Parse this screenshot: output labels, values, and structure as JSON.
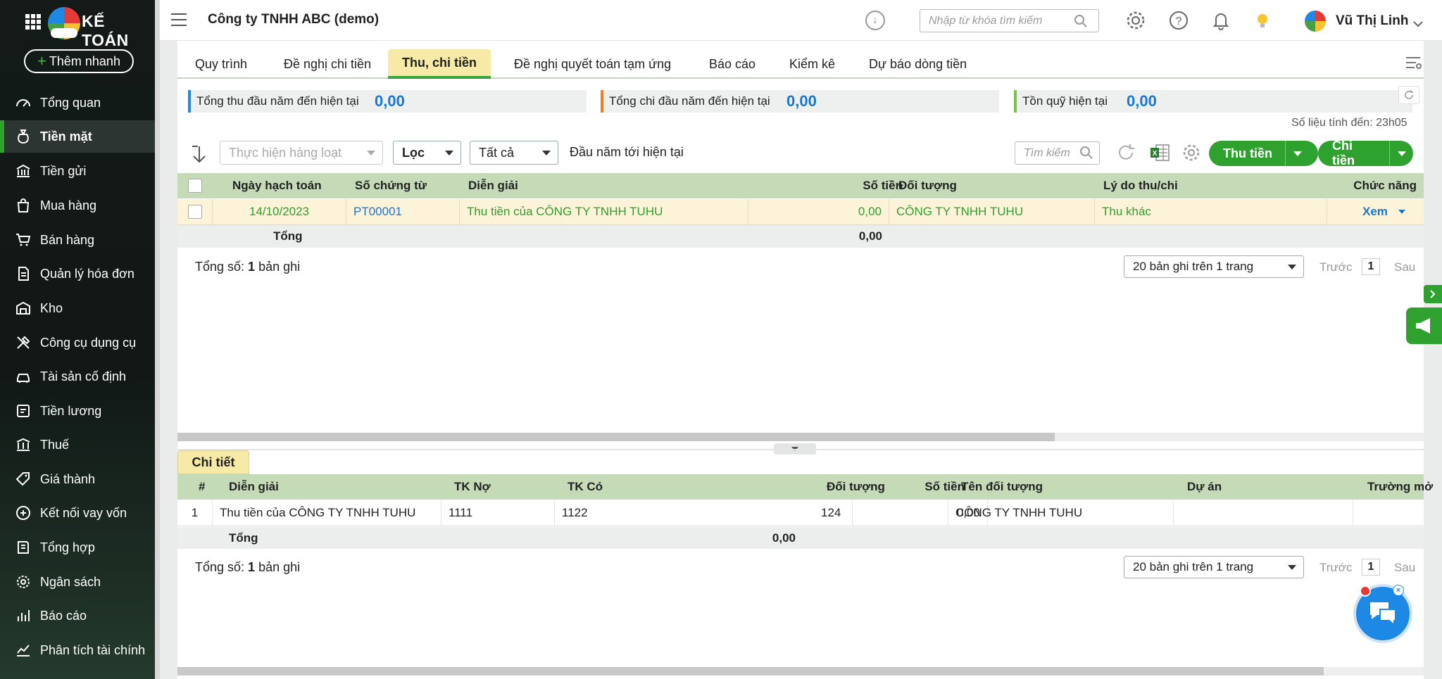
{
  "app": {
    "logo_text": "KẾ TOÁN",
    "add_button": "Thêm nhanh",
    "company": "Công ty TNHH ABC (demo)",
    "search_placeholder": "Nhập từ khóa tìm kiếm",
    "user_name": "Vũ Thị Linh"
  },
  "sidebar": {
    "items": [
      {
        "label": "Tổng quan",
        "icon": "dashboard-icon"
      },
      {
        "label": "Tiền mặt",
        "icon": "money-bag-icon",
        "active": true
      },
      {
        "label": "Tiền gửi",
        "icon": "bank-icon"
      },
      {
        "label": "Mua hàng",
        "icon": "shopping-bag-icon"
      },
      {
        "label": "Bán hàng",
        "icon": "cart-icon"
      },
      {
        "label": "Quản lý hóa đơn",
        "icon": "invoice-icon"
      },
      {
        "label": "Kho",
        "icon": "warehouse-icon"
      },
      {
        "label": "Công cụ dụng cụ",
        "icon": "tools-icon"
      },
      {
        "label": "Tài sản cố định",
        "icon": "car-icon"
      },
      {
        "label": "Tiền lương",
        "icon": "payroll-icon"
      },
      {
        "label": "Thuế",
        "icon": "tax-building-icon"
      },
      {
        "label": "Giá thành",
        "icon": "price-tag-icon"
      },
      {
        "label": "Kết nối vay vốn",
        "icon": "loan-connect-icon"
      },
      {
        "label": "Tổng hợp",
        "icon": "summary-book-icon"
      },
      {
        "label": "Ngân sách",
        "icon": "budget-coin-icon"
      },
      {
        "label": "Báo cáo",
        "icon": "bar-chart-icon"
      },
      {
        "label": "Phân tích tài chính",
        "icon": "line-chart-icon"
      }
    ]
  },
  "tabs": [
    "Quy trình",
    "Đề nghị chi tiền",
    "Thu, chi tiền",
    "Đề nghị quyết toán tạm ứng",
    "Báo cáo",
    "Kiểm kê",
    "Dự báo dòng tiền"
  ],
  "summary": {
    "income_label": "Tổng thu đầu năm đến hiện tại",
    "income_value": "0,00",
    "expense_label": "Tổng chi đầu năm đến hiện tại",
    "expense_value": "0,00",
    "balance_label": "Tồn quỹ hiện tại",
    "balance_value": "0,00",
    "as_of": "Số liệu tính đến: 23h05"
  },
  "toolbar": {
    "batch": "Thực hiện hàng loạt",
    "filter": "Lọc",
    "status": "Tất cả",
    "period": "Đầu năm tới hiện tại",
    "search_placeholder": "Tìm kiếm",
    "receipt_button": "Thu tiền",
    "payment_button": "Chi tiền"
  },
  "main_grid": {
    "headers": [
      "Ngày hạch toán",
      "Số chứng từ",
      "Diễn giải",
      "Số tiền",
      "Đối tượng",
      "Lý do thu/chi",
      "Chức năng"
    ],
    "rows": [
      {
        "date": "14/10/2023",
        "doc_no": "PT00001",
        "desc": "Thu tiền của CÔNG TY TNHH TUHU",
        "amount": "0,00",
        "object": "CÔNG TY TNHH TUHU",
        "reason": "Thu khác",
        "action": "Xem"
      }
    ],
    "total_label": "Tổng",
    "total_amount": "0,00",
    "count_prefix": "Tổng số: ",
    "count": "1",
    "count_suffix": " bản ghi",
    "pager": "20 bản ghi trên 1 trang",
    "prev": "Trước",
    "page": "1",
    "next": "Sau"
  },
  "detail": {
    "tab": "Chi tiết",
    "headers": [
      "#",
      "Diễn giải",
      "TK Nợ",
      "TK Có",
      "Số tiền",
      "Đối tượng",
      "Tên đối tượng",
      "Dự án",
      "Trường mở"
    ],
    "rows": [
      {
        "no": "1",
        "desc": "Thu tiền của CÔNG TY TNHH TUHU",
        "debit": "1111",
        "credit": "1122",
        "amount": "0,00",
        "object": "124",
        "object_name": "CÔNG TY TNHH TUHU",
        "project": "",
        "ext": ""
      }
    ],
    "total_label": "Tổng",
    "total_amount": "0,00",
    "count_prefix": "Tổng số: ",
    "count": "1",
    "count_suffix": " bản ghi",
    "pager": "20 bản ghi trên 1 trang",
    "prev": "Trước",
    "page": "1",
    "next": "Sau"
  },
  "colors": {
    "accent_green": "#2ea12e",
    "link_blue": "#1976d2",
    "row_highlight": "#fdf3d8",
    "header_green": "#c5dbb8"
  }
}
